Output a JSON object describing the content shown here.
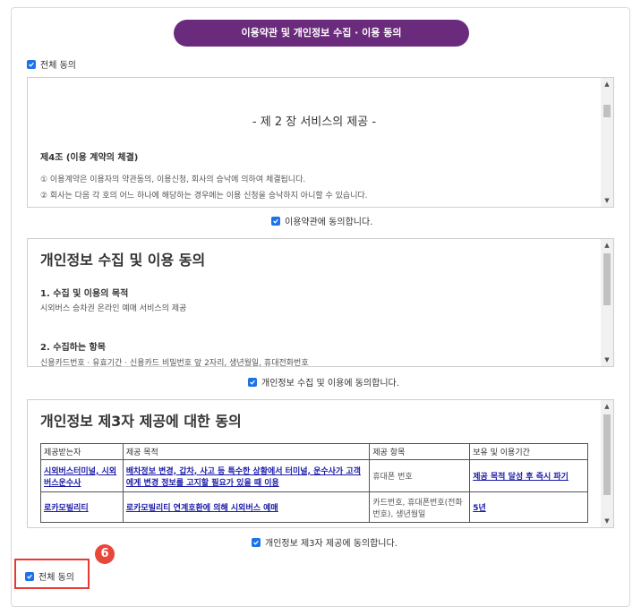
{
  "header": {
    "title": "이용약관 및 개인정보 수집 · 이용 동의"
  },
  "agree_all_top": {
    "label": "전체 동의"
  },
  "terms": {
    "chapter_title": "- 제 2 장 서비스의 제공 -",
    "article": "제4조 (이용 계약의 체결)",
    "lines": [
      "① 이용계약은 이용자의 약관동의, 이용신청, 회사의 승낙에 의하여 체결됩니다.",
      "② 회사는 다음 각 호의 어느 하나에 해당하는 경우에는 이용 신청을 승낙하지 아니할 수 있습니다."
    ],
    "agree_label": "이용약관에 동의합니다."
  },
  "privacy": {
    "heading": "개인정보 수집 및 이용 동의",
    "section1_title": "1. 수집 및 이용의 목적",
    "section1_text": "시외버스 승차권 온라인 예매 서비스의 제공",
    "section2_title": "2. 수집하는 항목",
    "section2_text": "신용카드번호 · 유효기간 · 신용카드 비밀번호 앞 2자리, 생년월일, 휴대전화번호",
    "agree_label": "개인정보 수집 및 이용에 동의합니다."
  },
  "third_party": {
    "heading": "개인정보 제3자 제공에 대한 동의",
    "columns": [
      "제공받는자",
      "제공 목적",
      "제공 항목",
      "보유 및 이용기간"
    ],
    "rows": [
      [
        "시외버스터미널, 시외버스운수사",
        "배차정보 변경, 갑차, 사고 등 특수한 상황에서 터미널, 운수사가 고객에게 변경 정보를 고지할 필요가 있을 때 이용",
        "휴대폰 번호",
        "제공 목적 달성 후 즉시 파기"
      ],
      [
        "로카모빌리티",
        "로카모빌리티 연계호환에 의해 시외버스 예매",
        "카드번호, 휴대폰번호(전화번호), 생년월일",
        "5년"
      ]
    ],
    "agree_label": "개인정보 제3자 제공에 동의합니다."
  },
  "agree_all_bottom": {
    "label": "전체 동의"
  },
  "annotation": {
    "step": "6"
  },
  "colors": {
    "header_bg": "#6b2b7c",
    "checkbox": "#1a73e8",
    "badge": "#e8473a",
    "highlight": "#e53935",
    "link": "#1a1aa8"
  }
}
